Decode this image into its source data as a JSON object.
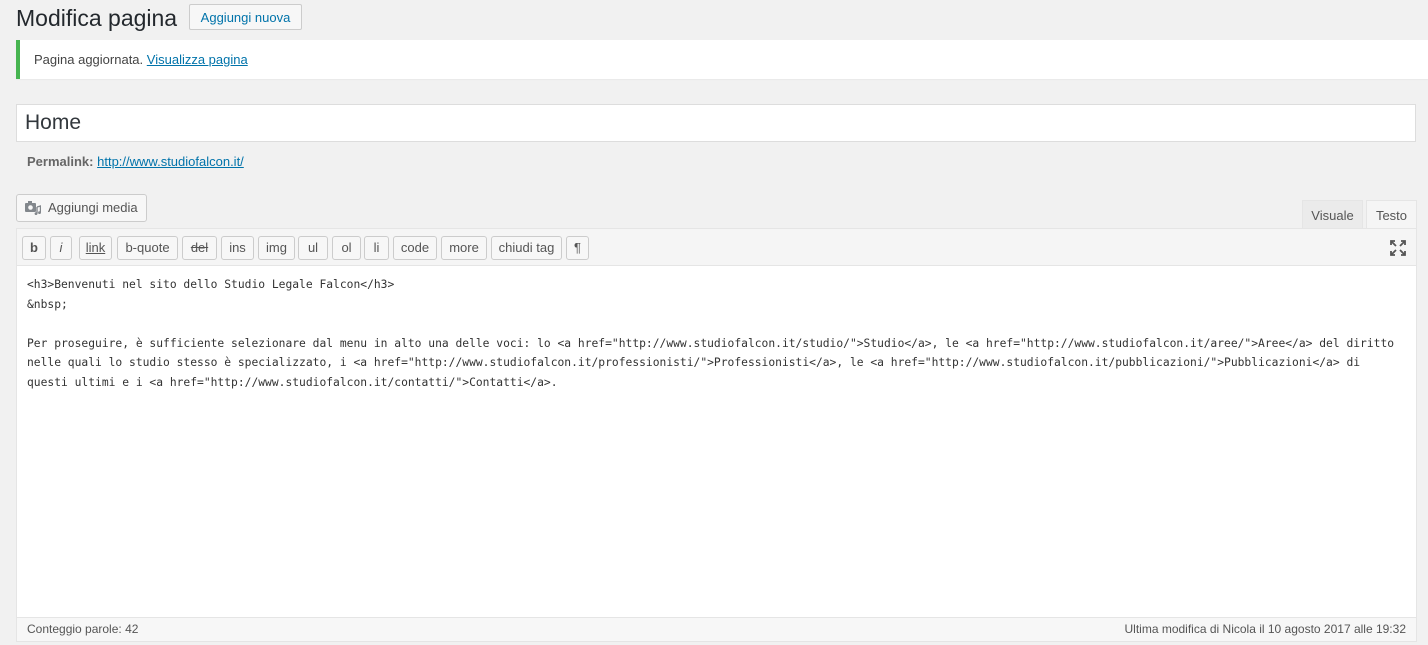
{
  "header": {
    "title": "Modifica pagina",
    "add_new_label": "Aggiungi nuova"
  },
  "notice": {
    "text": "Pagina aggiornata.",
    "link_text": "Visualizza pagina",
    "color": "#46b450"
  },
  "post": {
    "title": "Home",
    "permalink_label": "Permalink:",
    "permalink_url": "http://www.studiofalcon.it/"
  },
  "editor": {
    "add_media_label": "Aggiungi media",
    "tabs": [
      {
        "label": "Visuale",
        "active": false
      },
      {
        "label": "Testo",
        "active": true
      }
    ],
    "quicktags": [
      "b",
      "i",
      "link",
      "b-quote",
      "del",
      "ins",
      "img",
      "ul",
      "ol",
      "li",
      "code",
      "more",
      "chiudi tag",
      "¶"
    ],
    "content": "<h3>Benvenuti nel sito dello Studio Legale Falcon</h3>\n&nbsp;\n\nPer proseguire, è sufficiente selezionare dal menu in alto una delle voci: lo <a href=\"http://www.studiofalcon.it/studio/\">Studio</a>, le <a href=\"http://www.studiofalcon.it/aree/\">Aree</a> del diritto nelle quali lo studio stesso è specializzato, i <a href=\"http://www.studiofalcon.it/professionisti/\">Professionisti</a>, le <a href=\"http://www.studiofalcon.it/pubblicazioni/\">Pubblicazioni</a> di questi ultimi e i <a href=\"http://www.studiofalcon.it/contatti/\">Contatti</a>.",
    "word_count": "Conteggio parole: 42",
    "last_modified": "Ultima modifica di Nicola il 10 agosto 2017 alle 19:32"
  },
  "icons": {
    "add_media": "camera-music-icon",
    "fullscreen": "fullscreen-expand-icon"
  },
  "colors": {
    "link": "#0073aa",
    "background": "#f1f1f1"
  }
}
